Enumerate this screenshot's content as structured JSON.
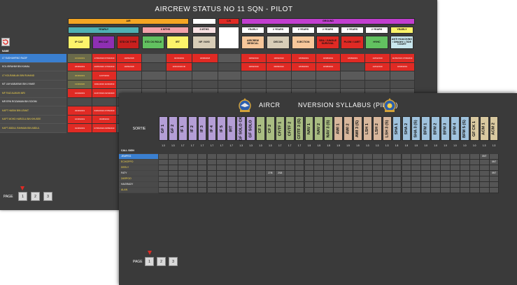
{
  "win1": {
    "title": "AIRCREW STATUS NO 11 SQN - PILOT",
    "groups": {
      "air": "AIR",
      "cs": "C/S",
      "ground": "GROUND"
    },
    "periods": {
      "yearly": "YEARLY",
      "six_mths": "6 MTHS",
      "three_mths": "3 MTHS"
    },
    "ground_periods": [
      "YEARLY",
      "2 YEARS",
      "2 YEARS",
      "2 YEARS",
      "2 YEARS",
      "2 YEARS",
      "YEARLY"
    ],
    "air_cols": [
      "IP CAT",
      "IRS CAT",
      "STD CK TYPE",
      "STD CK ROLE",
      "IRT",
      "NF / NVG"
    ],
    "ground_cols": [
      "AIRCREW MEDICAL",
      "DECON",
      "EJECTION",
      "SEA / JUNGLE SURVIVAL",
      "PLOW / LWET",
      "HYHC",
      "ANTI HIJACKING / DINGHY / TIDE COURT"
    ],
    "names_header": "NAME",
    "names": [
      "LT SUDHAHRNO RAZIF",
      "KOL IBRAHIM BIN KAMAL",
      "LT KOLRAMLAN BIN RUHAND",
      "MT LIM MUBARAK BIN LYMAR",
      "MF FAIZ ALMUIN MRI",
      "MR ERN ROZAIMAN BIN SOOIM",
      "KAPT HASIM BIN LEMAT",
      "KAPT MOHD HARIZUL BIN KHUSEE",
      "KAPT ABDUL RAHMAN BIN ABDUL"
    ],
    "cells": {
      "c1": [
        "10/04/2019",
        "18/06/2019",
        "30/06/2019",
        "13/06/2020",
        "10/04/2019",
        "",
        "29/06/2019",
        "16/06/2019",
        "01/06/2019"
      ],
      "c2": [
        "17/06/2019 07/03/2019",
        "20/05/2020 17/03/2019",
        "12/07/2019",
        "10/01/2019 11/03/2019",
        "21/07/2019 24/10/2020",
        "",
        "04/03/2019 27/05/2019",
        "03/08/2019",
        "07/05/2019 23/08/2019"
      ],
      "c3": [
        "19/06/2018",
        "19/06/2018",
        "",
        "",
        "",
        "",
        "",
        "",
        ""
      ],
      "c5": [
        "02/03/2019",
        "02/03/2019 NF",
        "",
        "",
        "",
        "",
        "",
        "",
        ""
      ],
      "c6": [
        "18/06/2018",
        "",
        "",
        "",
        "",
        "",
        "",
        "",
        ""
      ],
      "g1": [
        "18/09/2019",
        "18/09/2019",
        "",
        "",
        "",
        "",
        "",
        "",
        ""
      ],
      "g2": [
        "18/09/2019",
        "08/08/2019",
        "",
        "",
        "",
        "",
        "",
        "",
        ""
      ],
      "g3": [
        "18/09/2019",
        "18/09/2019",
        "",
        "",
        "",
        "",
        "",
        "",
        ""
      ],
      "g4": [
        "18/08/2019",
        "18/08/2019",
        "",
        "",
        "",
        "",
        "",
        "",
        ""
      ],
      "g5": [
        "18/09/2019",
        "",
        "",
        "",
        "",
        "",
        "",
        "",
        ""
      ],
      "g6": [
        "13/04/2019",
        "13/04/2019",
        "",
        "",
        "",
        "",
        "",
        "",
        ""
      ],
      "g7": [
        "11/06/2019 17/09/2019",
        "18/06/2019",
        "",
        "",
        "",
        "",
        "",
        "",
        ""
      ]
    },
    "pager": {
      "label": "PAGE",
      "pages": [
        "1",
        "2",
        "3"
      ]
    }
  },
  "win2": {
    "title_left": "AIRCR",
    "title_right": "NVERSION SYLLABUS (PILOT)",
    "sortie_label": "SORTIE",
    "call_sign_label": "CALL SIGN",
    "columns": [
      {
        "name": "GF 1",
        "sub": "1.3",
        "c": "#b49ed6"
      },
      {
        "name": "GF 2",
        "sub": "1.3",
        "c": "#b49ed6"
      },
      {
        "name": "IF 1",
        "sub": "1.7",
        "c": "#b49ed6"
      },
      {
        "name": "IF 2",
        "sub": "1.7",
        "c": "#b49ed6"
      },
      {
        "name": "IF 3",
        "sub": "1.7",
        "c": "#b49ed6"
      },
      {
        "name": "IF 4",
        "sub": "1.7",
        "c": "#b49ed6"
      },
      {
        "name": "IF 5",
        "sub": "1.7",
        "c": "#b49ed6"
      },
      {
        "name": "IRT",
        "sub": "1.7",
        "c": "#b49ed6"
      },
      {
        "name": "GF SOLO CK",
        "sub": "1.3",
        "c": "#b49ed6"
      },
      {
        "name": "GF SOLO",
        "sub": "1.3",
        "c": "#b49ed6"
      },
      {
        "name": "CF 1",
        "sub": "1.3",
        "c": "#a9bd82"
      },
      {
        "name": "CF 2",
        "sub": "1.3",
        "c": "#a9bd82"
      },
      {
        "name": "CF/TF 1",
        "sub": "1.7",
        "c": "#a9bd82"
      },
      {
        "name": "CF/TF 2",
        "sub": "1.7",
        "c": "#a9bd82"
      },
      {
        "name": "CF/TF 3 (S)",
        "sub": "1.7",
        "c": "#a9bd82"
      },
      {
        "name": "NAV 1",
        "sub": "1.5",
        "c": "#a9bd82"
      },
      {
        "name": "NAV 2",
        "sub": "1.5",
        "c": "#a9bd82"
      },
      {
        "name": "NAV 3 (S)",
        "sub": "1.5",
        "c": "#a9bd82"
      },
      {
        "name": "AWI 1",
        "sub": "1.5",
        "c": "#d8b79c"
      },
      {
        "name": "AWI 2",
        "sub": "1.5",
        "c": "#d8b79c"
      },
      {
        "name": "AWI 3 (S)",
        "sub": "1.5",
        "c": "#d8b79c"
      },
      {
        "name": "LSH 1",
        "sub": "1.3",
        "c": "#d8b79c"
      },
      {
        "name": "LSH 2",
        "sub": "1.3",
        "c": "#d8b79c"
      },
      {
        "name": "LSH 3 (S)",
        "sub": "1.3",
        "c": "#d8b79c"
      },
      {
        "name": "SHA 1",
        "sub": "1.5",
        "c": "#9fc2dd"
      },
      {
        "name": "SHA 2",
        "sub": "1.5",
        "c": "#9fc2dd"
      },
      {
        "name": "SHA 3 (S)",
        "sub": "1.5",
        "c": "#9fc2dd"
      },
      {
        "name": "BFM 1",
        "sub": "1.0",
        "c": "#9fc2dd"
      },
      {
        "name": "BFM 2",
        "sub": "1.0",
        "c": "#9fc2dd"
      },
      {
        "name": "BFM 3",
        "sub": "1.0",
        "c": "#9fc2dd"
      },
      {
        "name": "BFM 4",
        "sub": "1.0",
        "c": "#9fc2dd"
      },
      {
        "name": "BFM 5 (S)",
        "sub": "1.0",
        "c": "#9fc2dd"
      },
      {
        "name": "GF CK 1",
        "sub": "1.0",
        "c": "#d9c9a0"
      },
      {
        "name": "ACM 1",
        "sub": "1.3",
        "c": "#d9c9a0"
      },
      {
        "name": "ACM 2",
        "sub": "1.3",
        "c": "#d9c9a0"
      }
    ],
    "callsigns": [
      {
        "name": "JEMPEG",
        "color": "#ffffff",
        "bg": "#3a7fd0"
      },
      {
        "name": "ECHOPPO",
        "color": "#f5d64a",
        "bg": "#4a4a4a"
      },
      {
        "name": "DEELY",
        "color": "#f5d64a",
        "bg": "#4a4a4a"
      },
      {
        "name": "FATY",
        "color": "#ffffff",
        "bg": "#4a4a4a"
      },
      {
        "name": "ZARPOO",
        "color": "#f5d64a",
        "bg": "#4a4a4a"
      },
      {
        "name": "HAGRADY",
        "color": "#ffffff",
        "bg": "#4a4a4a"
      },
      {
        "name": "ALAN",
        "color": "#f5d64a",
        "bg": "#4a4a4a"
      }
    ],
    "marks": [
      {
        "row": 0,
        "col": 33,
        "text": "XNT"
      },
      {
        "row": 1,
        "col": 34,
        "text": "XNT"
      },
      {
        "row": 3,
        "col": 11,
        "text": "27/8"
      },
      {
        "row": 3,
        "col": 12,
        "text": "2/18"
      },
      {
        "row": 3,
        "col": 34,
        "text": "XNT"
      }
    ],
    "pager": {
      "label": "PAGE",
      "pages": [
        "1",
        "2",
        "3"
      ]
    }
  },
  "colors": {
    "red": "#e02a24",
    "blue": "#3a7fd0",
    "orange": "#f5a623",
    "yellow": "#fbf36a",
    "cyan": "#4fb1b3"
  }
}
